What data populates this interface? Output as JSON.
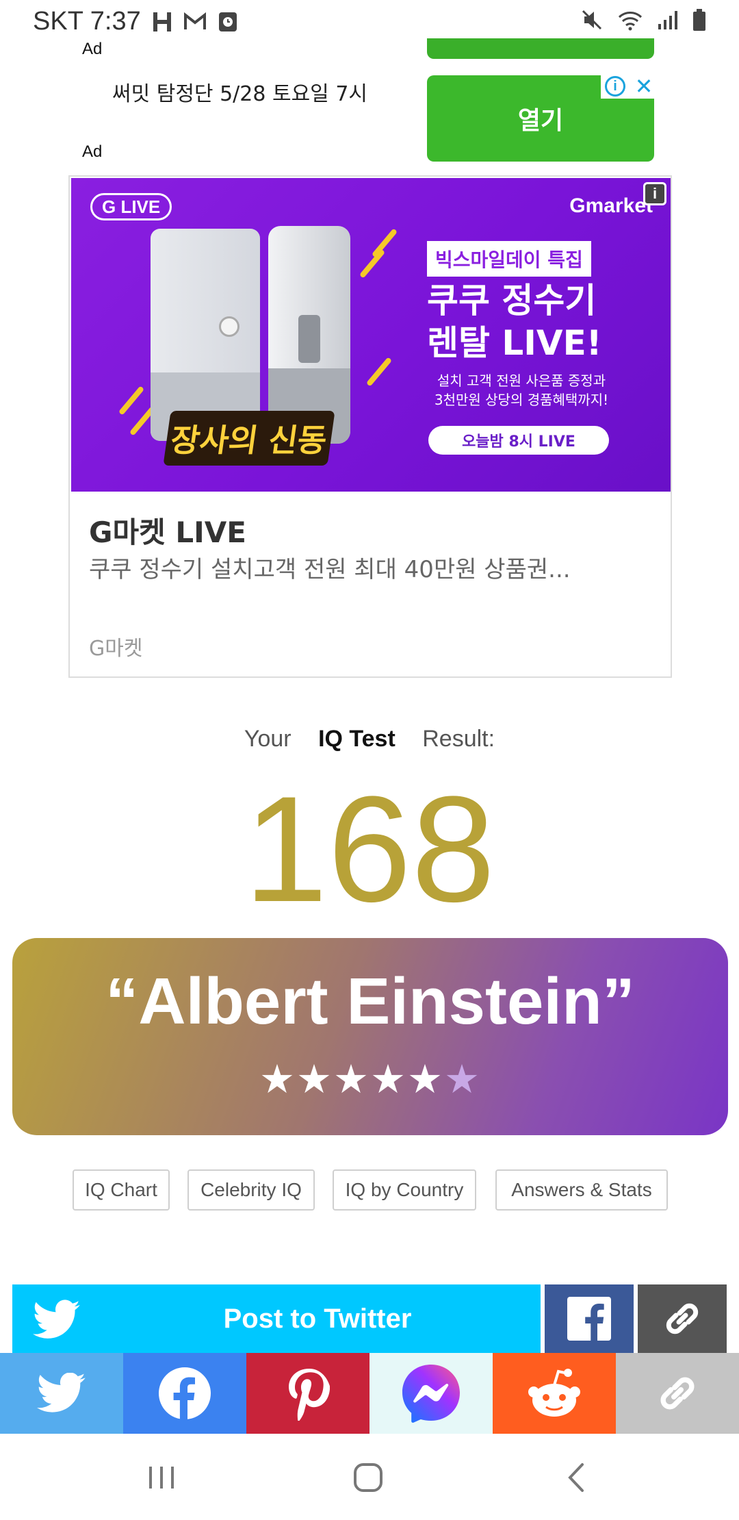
{
  "status_bar": {
    "carrier_time": "SKT 7:37"
  },
  "top_ad": {
    "ad_label_1": "Ad",
    "ad_label_2": "Ad",
    "headline": "써밋 탐정단 5/28 토요일 7시",
    "open_button": "열기"
  },
  "banner_ad": {
    "glive_badge": "G LIVE",
    "gmarket_logo": "Gmarket",
    "show_logo": "장사의 신동",
    "tag": "빅스마일데이 특집",
    "promo_line_1": "쿠쿠 정수기",
    "promo_line_2": "렌탈 LIVE!",
    "promo_sub_1": "설치 고객 전원 사은품 증정과",
    "promo_sub_2": "3천만원 상당의 경품혜택까지!",
    "promo_live": "오늘밤 8시 LIVE",
    "title": "G마켓 LIVE",
    "description": "쿠쿠 정수기 설치고객 전원 최대 40만원 상품권...",
    "brand": "G마켓"
  },
  "result": {
    "prefix": "Your",
    "test_name": "IQ Test",
    "suffix": "Result:",
    "score": "168",
    "rank_name": "“Albert Einstein”",
    "stars_filled": 5,
    "stars_total": 6
  },
  "links": [
    {
      "label": "IQ Chart"
    },
    {
      "label": "Celebrity IQ"
    },
    {
      "label": "IQ by Country"
    },
    {
      "label": "Answers & Stats"
    }
  ],
  "share": {
    "twitter_post_label": "Post to Twitter",
    "bar": [
      {
        "name": "twitter",
        "color": "#55acee"
      },
      {
        "name": "facebook",
        "color": "#3b82f0"
      },
      {
        "name": "pinterest",
        "color": "#c8233a"
      },
      {
        "name": "messenger",
        "color": "#e6f8f8"
      },
      {
        "name": "reddit",
        "color": "#ff5d1f"
      },
      {
        "name": "link",
        "color": "#c4c4c4"
      }
    ]
  },
  "colors": {
    "score_gold": "#b8a238",
    "open_button_green": "#3cb82c",
    "banner_purple": "#8a1fe0",
    "twitter_cyan": "#00c8ff"
  }
}
